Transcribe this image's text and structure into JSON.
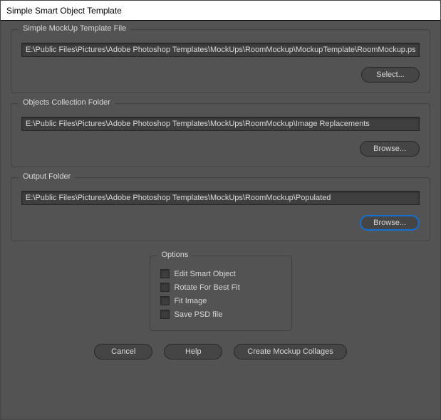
{
  "window_title": "Simple Smart Object Template",
  "groups": {
    "template_file": {
      "legend": "Simple MockUp Template File",
      "path": "E:\\Public Files\\Pictures\\Adobe Photoshop Templates\\MockUps\\RoomMockup\\MockupTemplate\\RoomMockup.psd",
      "button": "Select..."
    },
    "collection_folder": {
      "legend": "Objects Collection Folder",
      "path": "E:\\Public Files\\Pictures\\Adobe Photoshop Templates\\MockUps\\RoomMockup\\Image Replacements",
      "button": "Browse..."
    },
    "output_folder": {
      "legend": "Output Folder",
      "path": "E:\\Public Files\\Pictures\\Adobe Photoshop Templates\\MockUps\\RoomMockup\\Populated",
      "button": "Browse..."
    }
  },
  "options": {
    "legend": "Options",
    "items": [
      "Edit Smart Object",
      "Rotate For Best Fit",
      "Fit Image",
      "Save PSD file"
    ]
  },
  "actions": {
    "cancel": "Cancel",
    "help": "Help",
    "create": "Create Mockup Collages"
  }
}
